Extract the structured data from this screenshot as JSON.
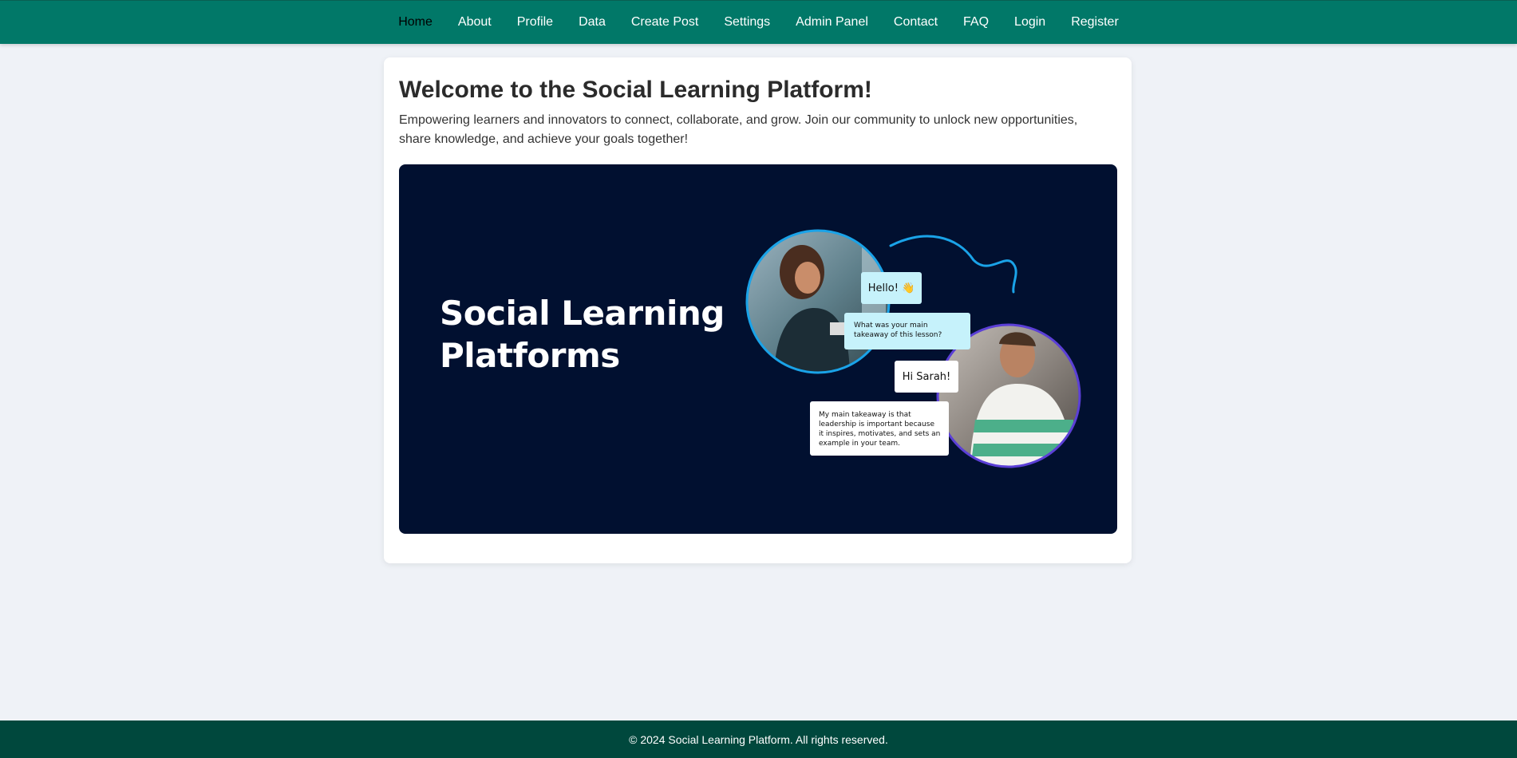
{
  "nav": {
    "items": [
      {
        "label": "Home",
        "active": true
      },
      {
        "label": "About"
      },
      {
        "label": "Profile"
      },
      {
        "label": "Data"
      },
      {
        "label": "Create Post"
      },
      {
        "label": "Settings"
      },
      {
        "label": "Admin Panel"
      },
      {
        "label": "Contact"
      },
      {
        "label": "FAQ"
      },
      {
        "label": "Login"
      },
      {
        "label": "Register"
      }
    ]
  },
  "main": {
    "title": "Welcome to the Social Learning Platform!",
    "intro": "Empowering learners and innovators to connect, collaborate, and grow. Join our community to unlock new opportunities, share knowledge, and achieve your goals together!",
    "banner": {
      "title_line1": "Social Learning",
      "title_line2": "Platforms",
      "chat": {
        "hello": "Hello! 👋",
        "question": "What was your main takeaway of this lesson?",
        "hi": "Hi Sarah!",
        "answer": "My main takeaway is that leadership is important because it inspires, motivates, and sets an example in your team."
      }
    }
  },
  "footer": {
    "text": "© 2024 Social Learning Platform. All rights reserved."
  },
  "colors": {
    "nav_bg": "#017868",
    "footer_bg": "#00483d",
    "page_bg": "#eff2f7",
    "banner_bg": "#011030",
    "bubble_cyan": "#c6f2fb",
    "accent_blue": "#1aa3e8",
    "accent_purple": "#5b3fd6"
  }
}
